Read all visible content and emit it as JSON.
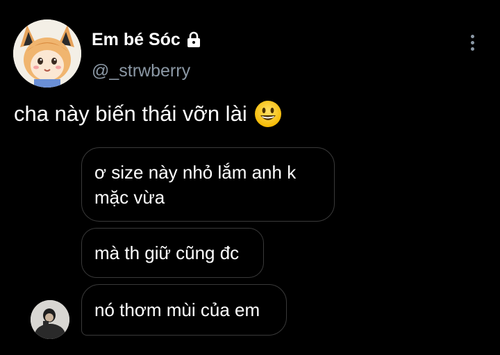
{
  "profile": {
    "display_name": "Em bé Sóc",
    "handle": "@_strwberry",
    "protected_icon": "lock-icon",
    "avatar_icon": "anime-avatar"
  },
  "menu": {
    "icon": "more-vertical-icon"
  },
  "tweet": {
    "text": "cha này biến thái vỡn lài",
    "emoji": "grinning-face-emoji"
  },
  "chat": {
    "messages": [
      {
        "text": "ơ size này nhỏ lắm anh k mặc vừa"
      },
      {
        "text": "mà th giữ cũng đc"
      },
      {
        "text": "nó thơm mùi của em"
      }
    ],
    "sender_avatar_icon": "person-photo-avatar"
  },
  "colors": {
    "background": "#000000",
    "text": "#ffffff",
    "muted": "#8b98a5",
    "bubble_border": "#3a3a3a"
  }
}
